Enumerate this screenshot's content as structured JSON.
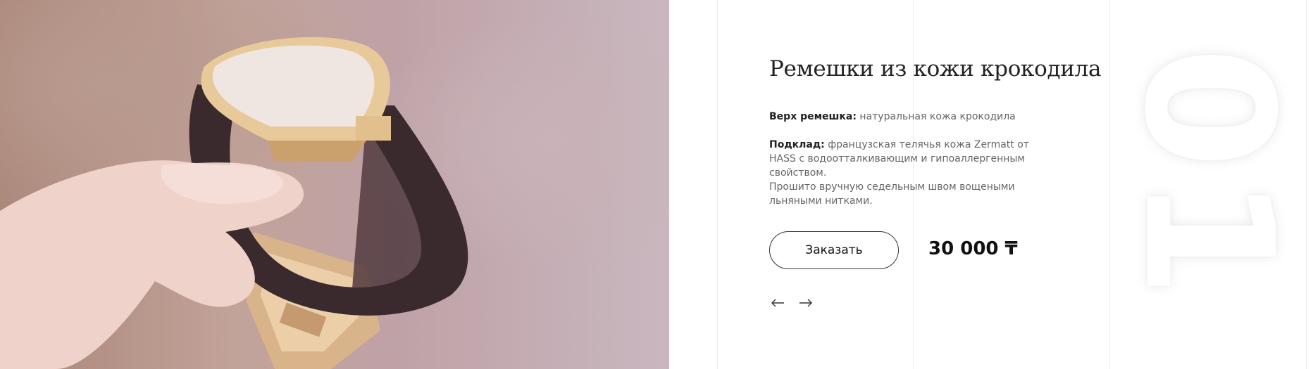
{
  "slide": {
    "title": "Ремешки из кожи крокодила",
    "number": "01",
    "specs": [
      {
        "label": "Верх ремешка:",
        "text": "натуральная кожа крокодила"
      },
      {
        "label": "Подклад:",
        "text": "французская телячья кожа Zermatt от HASS с водоотталкивающим и гипоаллергенным свойством."
      }
    ],
    "note": "Прошито вручную седельным швом вощеными льняными нитками.",
    "order_label": "Заказать",
    "price": "30 000 ₸"
  },
  "navigation": {
    "prev_icon": "arrow-left-icon",
    "next_icon": "arrow-right-icon"
  },
  "colors": {
    "text": "#222222",
    "muted_text": "#666666",
    "button_border": "#333333",
    "guide_lines": "#ececec"
  }
}
